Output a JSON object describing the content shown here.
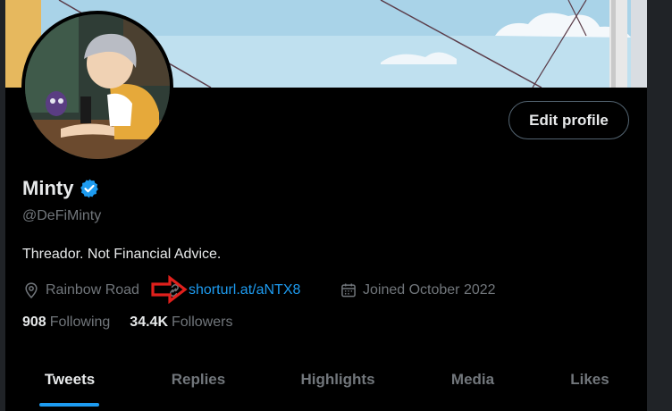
{
  "profile": {
    "name": "Minty",
    "handle": "@DeFiMinty",
    "bio": "Threador. Not Financial Advice.",
    "location": "Rainbow Road",
    "link": "shorturl.at/aNTX8",
    "joined": "Joined October 2022",
    "verified": true
  },
  "buttons": {
    "edit_profile": "Edit profile"
  },
  "stats": {
    "following_count": "908",
    "following_label": "Following",
    "followers_count": "34.4K",
    "followers_label": "Followers"
  },
  "tabs": [
    {
      "label": "Tweets",
      "active": true
    },
    {
      "label": "Replies",
      "active": false
    },
    {
      "label": "Highlights",
      "active": false
    },
    {
      "label": "Media",
      "active": false
    },
    {
      "label": "Likes",
      "active": false
    }
  ],
  "icons": {
    "location": "location-pin-icon",
    "link": "link-icon",
    "calendar": "calendar-icon",
    "verified": "verified-badge-icon",
    "annotation": "red-arrow-annotation"
  },
  "colors": {
    "accent": "#1d9bf0",
    "background": "#000000",
    "secondary_text": "#71767b",
    "annotation": "#e0201c"
  }
}
